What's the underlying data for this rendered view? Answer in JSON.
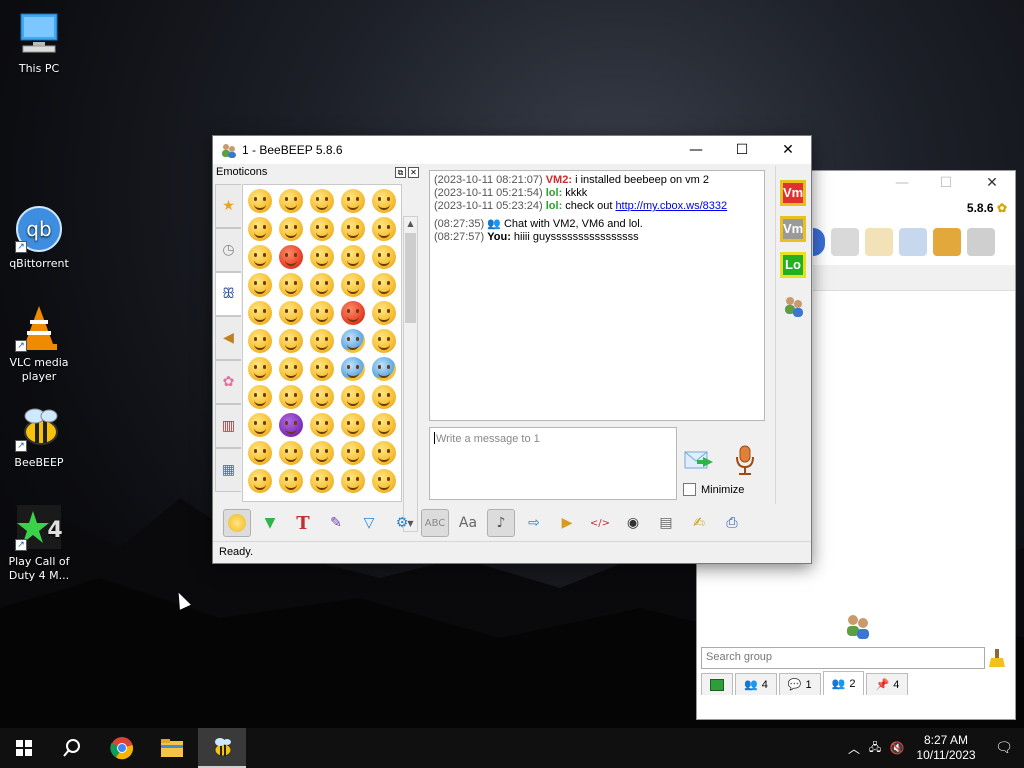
{
  "desktop": {
    "icons": [
      {
        "label": "This PC"
      },
      {
        "label": "qBittorrent"
      },
      {
        "label": "VLC media player"
      },
      {
        "label": "BeeBEEP"
      },
      {
        "label": "Play Call of Duty 4 M..."
      }
    ]
  },
  "back_window": {
    "version": "5.8.6",
    "search_placeholder": "Search group",
    "tabs": [
      {
        "icon": "monitor-icon",
        "count": ""
      },
      {
        "icon": "users-icon",
        "count": "4"
      },
      {
        "icon": "chat-icon",
        "count": "1"
      },
      {
        "icon": "group-icon",
        "count": "2"
      },
      {
        "icon": "share-icon",
        "count": "4"
      }
    ],
    "active_tab_index": 3
  },
  "window": {
    "title": "1 - BeeBEEP 5.8.6"
  },
  "emoticons": {
    "title": "Emoticons",
    "categories": [
      "star-icon",
      "clock-icon",
      "people-icon",
      "bell-icon",
      "flower-icon",
      "objects-icon",
      "symbols-icon"
    ],
    "active_category_index": 2
  },
  "chat": {
    "messages": [
      {
        "time": "(2023-10-11 08:21:07)",
        "sender": "VM2",
        "sender_style": "vm2",
        "text": " i installed beebeep on vm 2"
      },
      {
        "time": "(2023-10-11 05:21:54)",
        "sender": "lol",
        "sender_style": "lol",
        "text": " kkkk"
      },
      {
        "time": "(2023-10-11 05:23:24)",
        "sender": "lol",
        "sender_style": "lol",
        "text": " check out ",
        "link": "http://my.cbox.ws/8332"
      },
      {
        "time": "(08:27:35)",
        "sender": "",
        "sender_style": "system",
        "text": " Chat with VM2, VM6 and lol."
      },
      {
        "time": "(08:27:57)",
        "sender": "You",
        "sender_style": "you",
        "text": " hiiii guyssssssssssssssss"
      }
    ]
  },
  "compose": {
    "placeholder": "Write a message to 1",
    "minimize_label": "Minimize"
  },
  "side_users": [
    {
      "label": "Vm",
      "color": "#e03030",
      "border": "#e8c020"
    },
    {
      "label": "Vm",
      "color": "#9a9a9a",
      "border": "#e8c020"
    },
    {
      "label": "Lo",
      "color": "#20b020",
      "border": "#e8e020"
    }
  ],
  "status": "Ready.",
  "taskbar": {
    "time": "8:27 AM",
    "date": "10/11/2023"
  }
}
